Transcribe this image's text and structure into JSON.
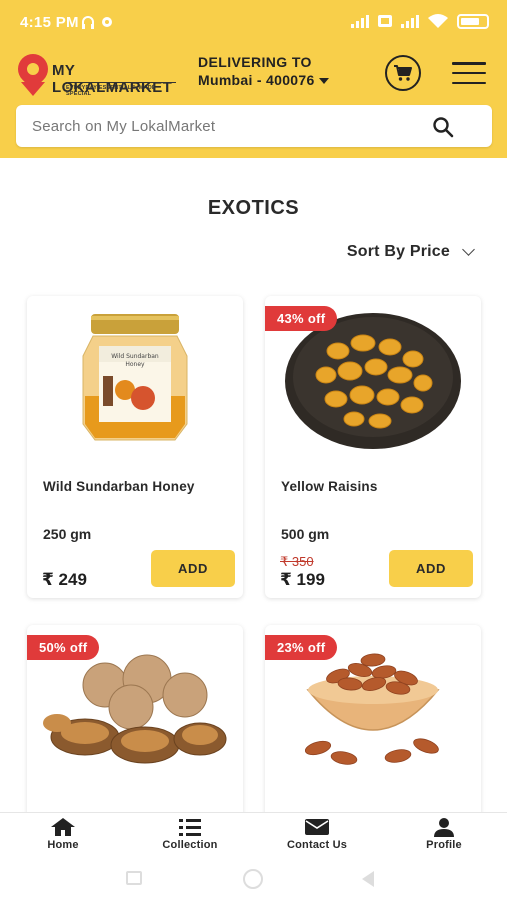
{
  "status": {
    "time": "4:15 PM",
    "battery": "73"
  },
  "brand": {
    "name": "MY LOKALMARKET",
    "tagline": "EVERYDAY ESSENTIALS, MADE SPECIAL"
  },
  "delivery": {
    "label": "DELIVERING TO",
    "location": "Mumbai - 400076"
  },
  "search": {
    "placeholder": "Search on My LokalMarket"
  },
  "page": {
    "title": "EXOTICS",
    "sort_label": "Sort By Price"
  },
  "products": [
    {
      "name": "Wild Sundarban Honey",
      "weight": "250 gm",
      "mrp": "",
      "price": "₹ 249",
      "badge": "",
      "add_label": "ADD"
    },
    {
      "name": "Yellow Raisins",
      "weight": "500 gm",
      "mrp": "₹ 350",
      "price": "₹ 199",
      "badge": "43% off",
      "add_label": "ADD"
    },
    {
      "name": "",
      "weight": "",
      "mrp": "",
      "price": "",
      "badge": "50% off",
      "add_label": ""
    },
    {
      "name": "",
      "weight": "",
      "mrp": "",
      "price": "",
      "badge": "23% off",
      "add_label": ""
    }
  ],
  "nav": [
    {
      "label": "Home",
      "icon": "home-icon"
    },
    {
      "label": "Collection",
      "icon": "list-icon"
    },
    {
      "label": "Contact Us",
      "icon": "mail-icon"
    },
    {
      "label": "Profile",
      "icon": "user-icon"
    }
  ],
  "colors": {
    "header": "#f8cf4a",
    "badge": "#e03a3a",
    "button": "#f8cf4a",
    "brand_red": "#e13b3b"
  }
}
